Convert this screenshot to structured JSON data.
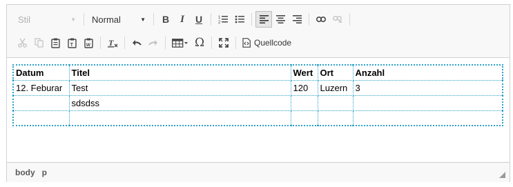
{
  "toolbar": {
    "style_combo": {
      "label": "Stil"
    },
    "format_combo": {
      "label": "Normal"
    },
    "source_label": "Quellcode"
  },
  "table": {
    "headers": [
      "Datum",
      "Titel",
      "Wert",
      "Ort",
      "Anzahl"
    ],
    "rows": [
      [
        "12. Feburar",
        "Test",
        "120",
        "Luzern",
        "3"
      ],
      [
        "",
        "sdsdss",
        "",
        "",
        ""
      ],
      [
        "",
        "",
        "",
        "",
        ""
      ]
    ]
  },
  "statusbar": {
    "path": [
      "body",
      "p"
    ]
  }
}
